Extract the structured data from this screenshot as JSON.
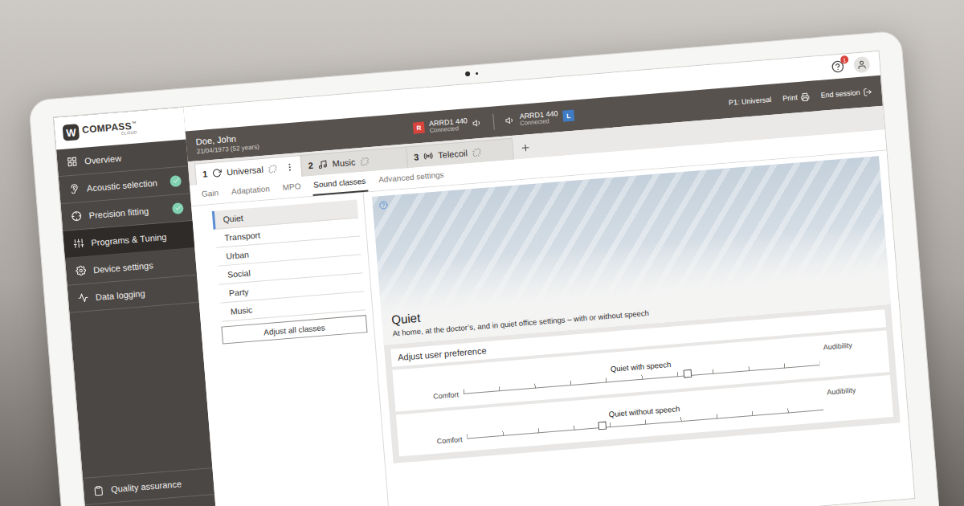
{
  "logo": {
    "mark": "W",
    "name": "COMPASS",
    "tm": "™",
    "sub": "CLOUD"
  },
  "header": {
    "help_badge": "1"
  },
  "patient": {
    "name": "Doe, John",
    "dob": "21/04/1973 (52 years)"
  },
  "devices": [
    {
      "side": "R",
      "model": "ARRD1 440",
      "status": "Connected",
      "color": "#d8433c"
    },
    {
      "side": "L",
      "model": "ARRD1 440",
      "status": "Connected",
      "color": "#3f7cc4"
    }
  ],
  "session": {
    "program": "P1: Universal",
    "print": "Print",
    "end": "End session"
  },
  "sidebar": {
    "items": [
      {
        "label": "Overview",
        "done": false,
        "selected": false
      },
      {
        "label": "Acoustic selection",
        "done": true,
        "selected": false
      },
      {
        "label": "Precision fitting",
        "done": true,
        "selected": false
      },
      {
        "label": "Programs & Tuning",
        "done": false,
        "selected": true
      },
      {
        "label": "Device settings",
        "done": false,
        "selected": false
      },
      {
        "label": "Data logging",
        "done": false,
        "selected": false
      }
    ],
    "footer": "Quality assurance"
  },
  "program_tabs": [
    {
      "number": "1",
      "label": "Universal",
      "selected": true
    },
    {
      "number": "2",
      "label": "Music",
      "selected": false
    },
    {
      "number": "3",
      "label": "Telecoil",
      "selected": false
    }
  ],
  "sub_tabs": [
    {
      "label": "Gain",
      "selected": false
    },
    {
      "label": "Adaptation",
      "selected": false
    },
    {
      "label": "MPO",
      "selected": false
    },
    {
      "label": "Sound classes",
      "selected": true
    },
    {
      "label": "Advanced settings",
      "selected": false
    }
  ],
  "sound_classes": {
    "items": [
      {
        "label": "Quiet",
        "selected": true
      },
      {
        "label": "Transport",
        "selected": false
      },
      {
        "label": "Urban",
        "selected": false
      },
      {
        "label": "Social",
        "selected": false
      },
      {
        "label": "Party",
        "selected": false
      },
      {
        "label": "Music",
        "selected": false
      }
    ],
    "adjust_all": "Adjust all classes"
  },
  "detail": {
    "title": "Quiet",
    "description": "At home, at the doctor’s, and in quiet office settings – with or without speech",
    "preference_title": "Adjust user preference",
    "sliders": [
      {
        "label": "Quiet with speech",
        "left": "Comfort",
        "right": "Audibility",
        "level": 0.63
      },
      {
        "label": "Quiet without speech",
        "left": "Comfort",
        "right": "Audibility",
        "level": 0.38
      }
    ]
  }
}
